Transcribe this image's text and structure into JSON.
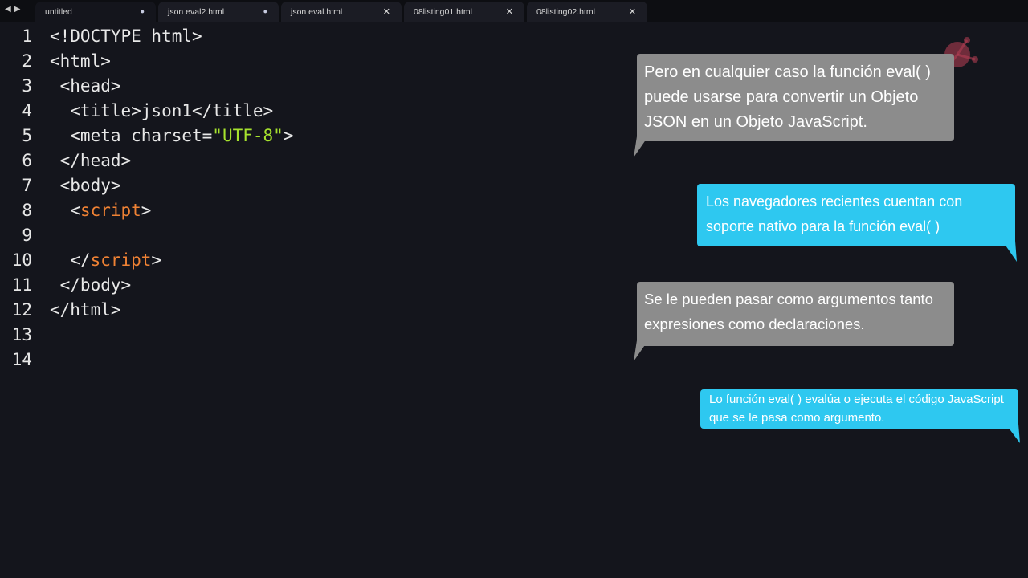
{
  "tabs": [
    {
      "label": "untitled",
      "control": "dot",
      "active": true
    },
    {
      "label": "json eval2.html",
      "control": "dot",
      "active": false
    },
    {
      "label": "json eval.html",
      "control": "close",
      "active": false
    },
    {
      "label": "08listing01.html",
      "control": "close",
      "active": false
    },
    {
      "label": "08listing02.html",
      "control": "close",
      "active": false
    }
  ],
  "tab_controls": {
    "dot": "●",
    "close": "✕"
  },
  "line_numbers": [
    "1",
    "2",
    "3",
    "4",
    "5",
    "6",
    "7",
    "8",
    "9",
    "10",
    "11",
    "12",
    "13",
    "14"
  ],
  "code": {
    "l1": "<!DOCTYPE html>",
    "l2": "<html>",
    "l3": " <head>",
    "l4": "  <title>json1</title>",
    "l5_a": "  <meta charset=",
    "l5_b": "\"UTF-8\"",
    "l5_c": ">",
    "l6": " </head>",
    "l7": " <body>",
    "l8_a": "  <",
    "l8_b": "script",
    "l8_c": ">",
    "l10_a": "  </",
    "l10_b": "script",
    "l10_c": ">",
    "l11": " </body>",
    "l12": "</html>"
  },
  "bubbles": {
    "b1": "Pero en cualquier caso la función eval( ) puede usarse para convertir un Objeto JSON en un Objeto JavaScript.",
    "b2": "Los navegadores recientes cuentan con soporte nativo para la función eval( )",
    "b3": "Se le pueden pasar como argumentos tanto expresiones como declaraciones.",
    "b4": "Lo función eval( ) evalúa o ejecuta el código JavaScript que se le pasa como argumento."
  },
  "colors": {
    "background": "#14151c",
    "string": "#a6e22e",
    "script_tag": "#f08234",
    "bubble_gray": "#8c8c8c",
    "bubble_blue": "#2ec8f0"
  }
}
